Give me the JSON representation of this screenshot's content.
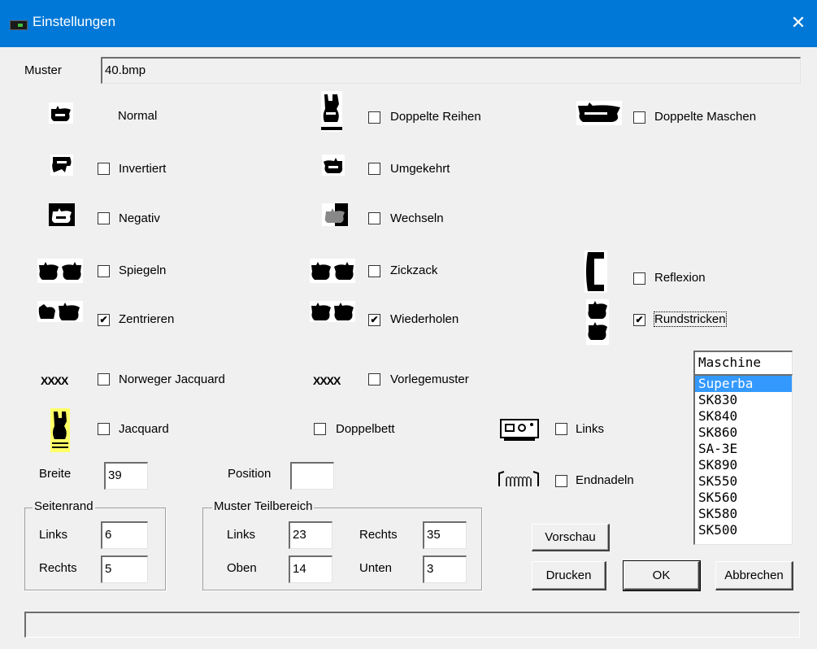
{
  "window": {
    "title": "Einstellungen",
    "close_glyph": "✕"
  },
  "muster": {
    "label": "Muster",
    "value": "40.bmp"
  },
  "options": {
    "normal": {
      "label": "Normal"
    },
    "doppelte_reihen": {
      "label": "Doppelte Reihen",
      "checked": false
    },
    "doppelte_maschen": {
      "label": "Doppelte Maschen",
      "checked": false
    },
    "invertiert": {
      "label": "Invertiert",
      "checked": false
    },
    "umgekehrt": {
      "label": "Umgekehrt",
      "checked": false
    },
    "negativ": {
      "label": "Negativ",
      "checked": false
    },
    "wechseln": {
      "label": "Wechseln",
      "checked": false
    },
    "spiegeln": {
      "label": "Spiegeln",
      "checked": false
    },
    "zickzack": {
      "label": "Zickzack",
      "checked": false
    },
    "reflexion": {
      "label": "Reflexion",
      "checked": false
    },
    "zentrieren": {
      "label": "Zentrieren",
      "checked": true
    },
    "wiederholen": {
      "label": "Wiederholen",
      "checked": true
    },
    "rundstricken": {
      "label": "Rundstricken",
      "checked": true
    },
    "norweger_jacquard": {
      "label": "Norweger Jacquard",
      "checked": false,
      "icon_text": "XXXX"
    },
    "vorlegemuster": {
      "label": "Vorlegemuster",
      "checked": false,
      "icon_text": "XXXX"
    },
    "jacquard": {
      "label": "Jacquard",
      "checked": false
    },
    "doppelbett": {
      "label": "Doppelbett",
      "checked": false
    },
    "links": {
      "label": "Links",
      "checked": false
    },
    "endnadeln": {
      "label": "Endnadeln",
      "checked": false
    }
  },
  "breite": {
    "label": "Breite",
    "value": "39"
  },
  "position": {
    "label": "Position",
    "value": ""
  },
  "seitenrand": {
    "legend": "Seitenrand",
    "links_label": "Links",
    "links_value": "6",
    "rechts_label": "Rechts",
    "rechts_value": "5"
  },
  "teilbereich": {
    "legend": "Muster Teilbereich",
    "links_label": "Links",
    "links_value": "23",
    "rechts_label": "Rechts",
    "rechts_value": "35",
    "oben_label": "Oben",
    "oben_value": "14",
    "unten_label": "Unten",
    "unten_value": "3"
  },
  "maschine": {
    "header": "Maschine",
    "selected": "Superba",
    "items": [
      "Superba",
      "SK830",
      "SK840",
      "SK860",
      "SA-3E",
      "SK890",
      "SK550",
      "SK560",
      "SK580",
      "SK500"
    ]
  },
  "buttons": {
    "vorschau": "Vorschau",
    "drucken": "Drucken",
    "ok": "OK",
    "abbrechen": "Abbrechen"
  },
  "status": {
    "text": ""
  },
  "colors": {
    "titlebar": "#0078d7",
    "selection": "#3399ff",
    "jacquard_icon": "#ffff66"
  }
}
